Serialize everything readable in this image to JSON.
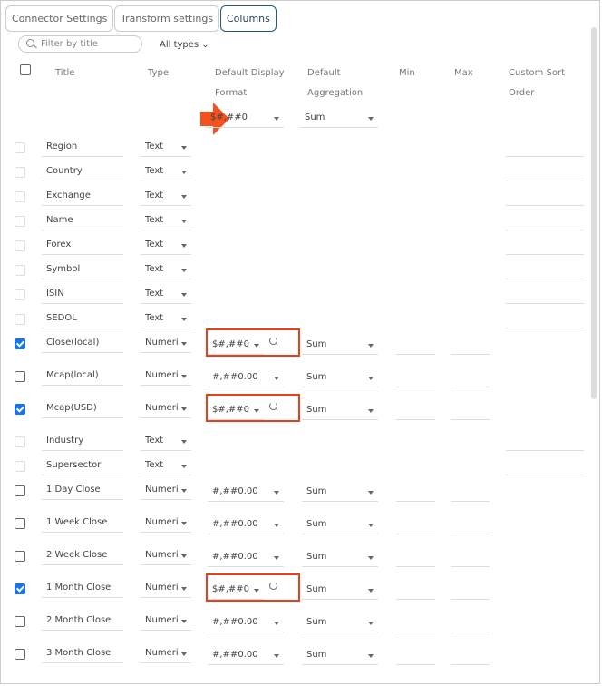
{
  "tabs": [
    {
      "label": "Connector Settings"
    },
    {
      "label": "Transform settings"
    },
    {
      "label": "Columns"
    }
  ],
  "filter": {
    "placeholder": "Filter by title",
    "types_label": "All types ⌄"
  },
  "headers": {
    "title": "Title",
    "type": "Type",
    "format1": "Default Display",
    "format2": "Format",
    "agg1": "Default",
    "agg2": "Aggregation",
    "min": "Min",
    "max": "Max",
    "sort1": "Custom Sort",
    "sort2": "Order"
  },
  "defaults": {
    "format": "$#,##0",
    "aggregation": "Sum"
  },
  "colors": {
    "accent": "#1a73e8",
    "highlight": "#e8401c"
  },
  "rows": [
    {
      "title": "Region",
      "type": "Text",
      "checked": false,
      "numeric": false
    },
    {
      "title": "Country",
      "type": "Text",
      "checked": false,
      "numeric": false
    },
    {
      "title": "Exchange",
      "type": "Text",
      "checked": false,
      "numeric": false
    },
    {
      "title": "Name",
      "type": "Text",
      "checked": false,
      "numeric": false
    },
    {
      "title": "Forex",
      "type": "Text",
      "checked": false,
      "numeric": false
    },
    {
      "title": "Symbol",
      "type": "Text",
      "checked": false,
      "numeric": false
    },
    {
      "title": "ISIN",
      "type": "Text",
      "checked": false,
      "numeric": false
    },
    {
      "title": "SEDOL",
      "type": "Text",
      "checked": false,
      "numeric": false
    },
    {
      "title": "Close(local)",
      "type": "Numeri",
      "checked": true,
      "numeric": true,
      "format": "$#,##0",
      "aggregation": "Sum"
    },
    {
      "title": "Mcap(local)",
      "type": "Numeri",
      "checked": false,
      "numeric": true,
      "format": "#,##0.00",
      "aggregation": "Sum"
    },
    {
      "title": "Mcap(USD)",
      "type": "Numeri",
      "checked": true,
      "numeric": true,
      "format": "$#,##0",
      "aggregation": "Sum"
    },
    {
      "title": "Industry",
      "type": "Text",
      "checked": false,
      "numeric": false
    },
    {
      "title": "Supersector",
      "type": "Text",
      "checked": false,
      "numeric": false
    },
    {
      "title": "1 Day Close",
      "type": "Numeri",
      "checked": false,
      "numeric": true,
      "format": "#,##0.00",
      "aggregation": "Sum"
    },
    {
      "title": "1 Week Close",
      "type": "Numeri",
      "checked": false,
      "numeric": true,
      "format": "#,##0.00",
      "aggregation": "Sum"
    },
    {
      "title": "2 Week Close",
      "type": "Numeri",
      "checked": false,
      "numeric": true,
      "format": "#,##0.00",
      "aggregation": "Sum"
    },
    {
      "title": "1 Month Close",
      "type": "Numeri",
      "checked": true,
      "numeric": true,
      "format": "$#,##0",
      "aggregation": "Sum"
    },
    {
      "title": "2 Month Close",
      "type": "Numeri",
      "checked": false,
      "numeric": true,
      "format": "#,##0.00",
      "aggregation": "Sum"
    },
    {
      "title": "3 Month Close",
      "type": "Numeri",
      "checked": false,
      "numeric": true,
      "format": "#,##0.00",
      "aggregation": "Sum"
    }
  ]
}
